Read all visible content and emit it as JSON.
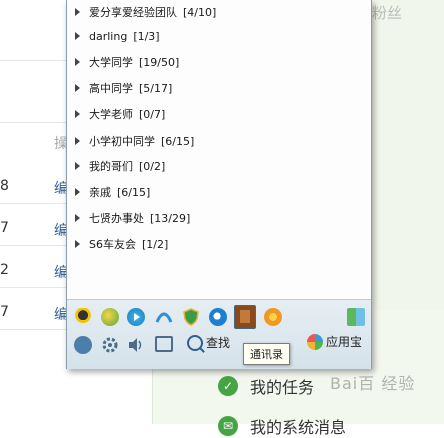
{
  "groups": [
    {
      "name": "爱分享爱经验团队",
      "count": "[4/10]"
    },
    {
      "name": "darling",
      "count": "[1/3]"
    },
    {
      "name": "大学同学",
      "count": "[19/50]"
    },
    {
      "name": "高中同学",
      "count": "[5/17]"
    },
    {
      "name": "大学老师",
      "count": "[0/7]"
    },
    {
      "name": "小学初中同学",
      "count": "[6/15]"
    },
    {
      "name": "我的哥们",
      "count": "[0/2]"
    },
    {
      "name": "亲戚",
      "count": "[6/15]"
    },
    {
      "name": "七贤办事处",
      "count": "[13/29]"
    },
    {
      "name": "S6车友会",
      "count": "[1/2]"
    }
  ],
  "toolbar": {
    "search_label": "查找",
    "app_center_label": "应用宝",
    "tooltip": "通讯录",
    "icons_row1": [
      "qq-penguin-icon",
      "qq-game-icon",
      "video-play-icon",
      "qq-music-icon",
      "security-shield-icon",
      "qq-browser-icon",
      "address-book-icon",
      "qzone-icon"
    ],
    "icons_row2": [
      "qq-main-menu-icon",
      "settings-gear-icon",
      "sound-icon",
      "message-manager-icon"
    ]
  },
  "background": {
    "fans_label": "粉丝",
    "operation_header": "操",
    "rows": [
      {
        "num": "8",
        "edit": "编"
      },
      {
        "num": "7",
        "edit": "编"
      },
      {
        "num": "2",
        "edit": "编"
      },
      {
        "num": "7",
        "edit": "编"
      }
    ],
    "tasks_label": "我的任务",
    "next_item_label": "我的系统消息",
    "watermark": "Bai百 经验"
  }
}
